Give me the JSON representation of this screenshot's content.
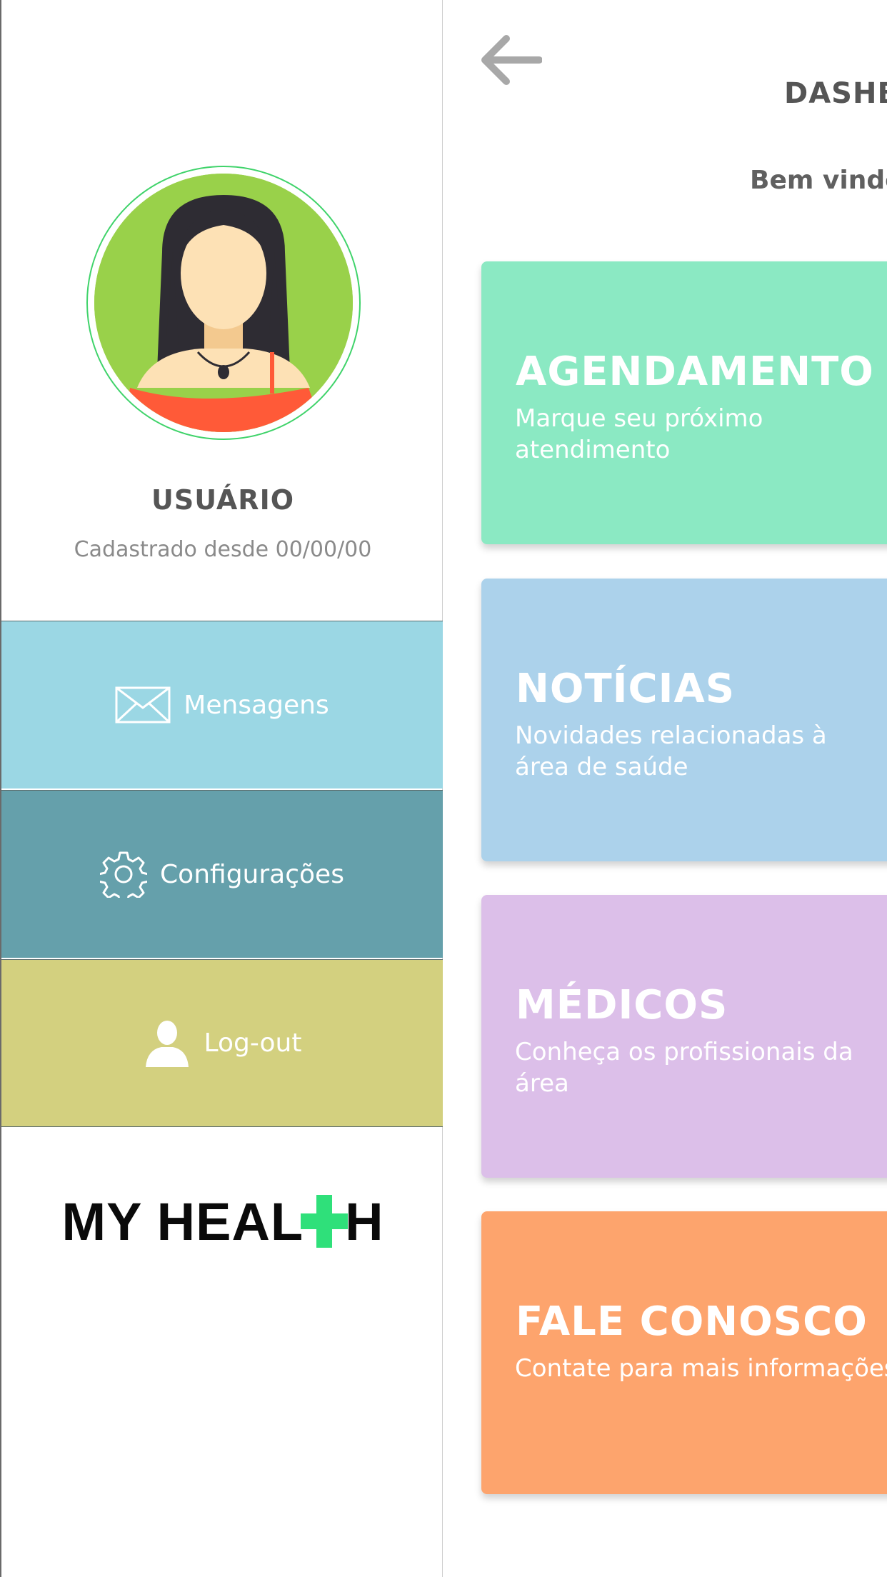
{
  "drawer": {
    "user": {
      "name": "USUÁRIO",
      "since": "Cadastrado desde 00/00/00"
    },
    "menu": [
      {
        "label": "Mensagens",
        "icon": "envelope-icon",
        "color": "#9bd7e4"
      },
      {
        "label": "Configurações",
        "icon": "gear-icon",
        "color": "#65a0ab"
      },
      {
        "label": "Log-out",
        "icon": "user-icon",
        "color": "#d3d07f"
      }
    ],
    "logo": {
      "left": "MY HEAL",
      "right": "H",
      "cross_color": "#2fe07a"
    }
  },
  "main": {
    "title": "DASHBOARD",
    "welcome": "Bem vindo",
    "cards": [
      {
        "title": "AGENDAMENTO",
        "desc": "Marque seu próximo atendimento",
        "color": "#8be9c3"
      },
      {
        "title": "NOTÍCIAS",
        "desc": "Novidades relacionadas à área de saúde",
        "color": "#acd2eb"
      },
      {
        "title": "MÉDICOS",
        "desc": "Conheça os profissionais da área",
        "color": "#dcbfe9"
      },
      {
        "title": "FALE CONOSCO",
        "desc": "Contate para mais informações",
        "color": "#fda46d"
      }
    ]
  }
}
